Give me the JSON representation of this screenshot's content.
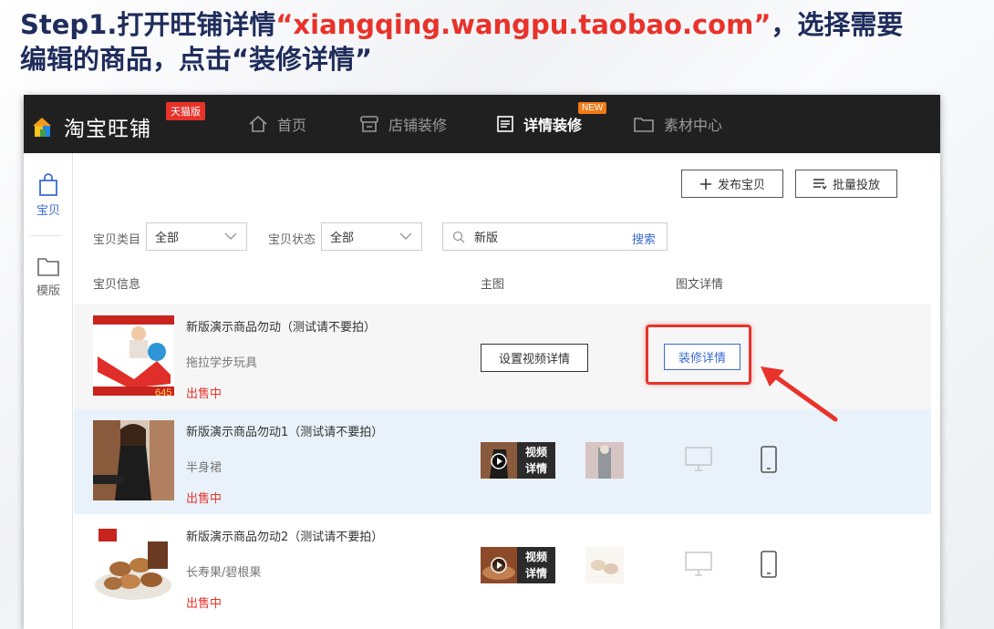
{
  "slide": {
    "title_prefix": "Step1.打开旺铺详情",
    "title_url": "“xiangqing.wangpu.taobao.com”",
    "title_suffix": "，选择需要",
    "title_line2": "编辑的商品，点击“装修详情”"
  },
  "app": {
    "logo_text": "淘宝旺铺",
    "tmall_badge": "天猫版",
    "nav": [
      {
        "label": "首页",
        "icon": "home-icon"
      },
      {
        "label": "店铺装修",
        "icon": "store-icon"
      },
      {
        "label": "详情装修",
        "icon": "document-icon",
        "active": true,
        "badge": "NEW"
      },
      {
        "label": "素材中心",
        "icon": "folder-icon"
      }
    ]
  },
  "rail": {
    "items": [
      {
        "label": "宝贝",
        "icon": "bag-icon",
        "active": true
      },
      {
        "label": "模版",
        "icon": "folder-icon"
      }
    ]
  },
  "toolbar": {
    "publish_label": "发布宝贝",
    "batch_label": "批量投放"
  },
  "filters": {
    "category_label": "宝贝类目",
    "category_value": "全部",
    "status_label": "宝贝状态",
    "status_value": "全部",
    "search_value": "新版",
    "search_button": "搜索"
  },
  "table": {
    "headers": [
      "宝贝信息",
      "主图",
      "图文详情"
    ],
    "rows": [
      {
        "title": "新版演示商品勿动（测试请不要拍）",
        "category": "拖拉学步玩具",
        "status": "出售中",
        "video_button": "设置视频详情",
        "decorate_button": "装修详情",
        "thumb_price": "645"
      },
      {
        "title": "新版演示商品勿动1（测试请不要拍）",
        "category": "半身裙",
        "status": "出售中",
        "video_label_1": "视频",
        "video_label_2": "详情"
      },
      {
        "title": "新版演示商品勿动2（测试请不要拍）",
        "category": "长寿果/碧根果",
        "status": "出售中",
        "video_label_1": "视频",
        "video_label_2": "详情"
      }
    ]
  },
  "colors": {
    "accent_red": "#e8322a",
    "link_blue": "#3a6bd2",
    "topbar": "#202020",
    "title_navy": "#1f2d5c"
  }
}
